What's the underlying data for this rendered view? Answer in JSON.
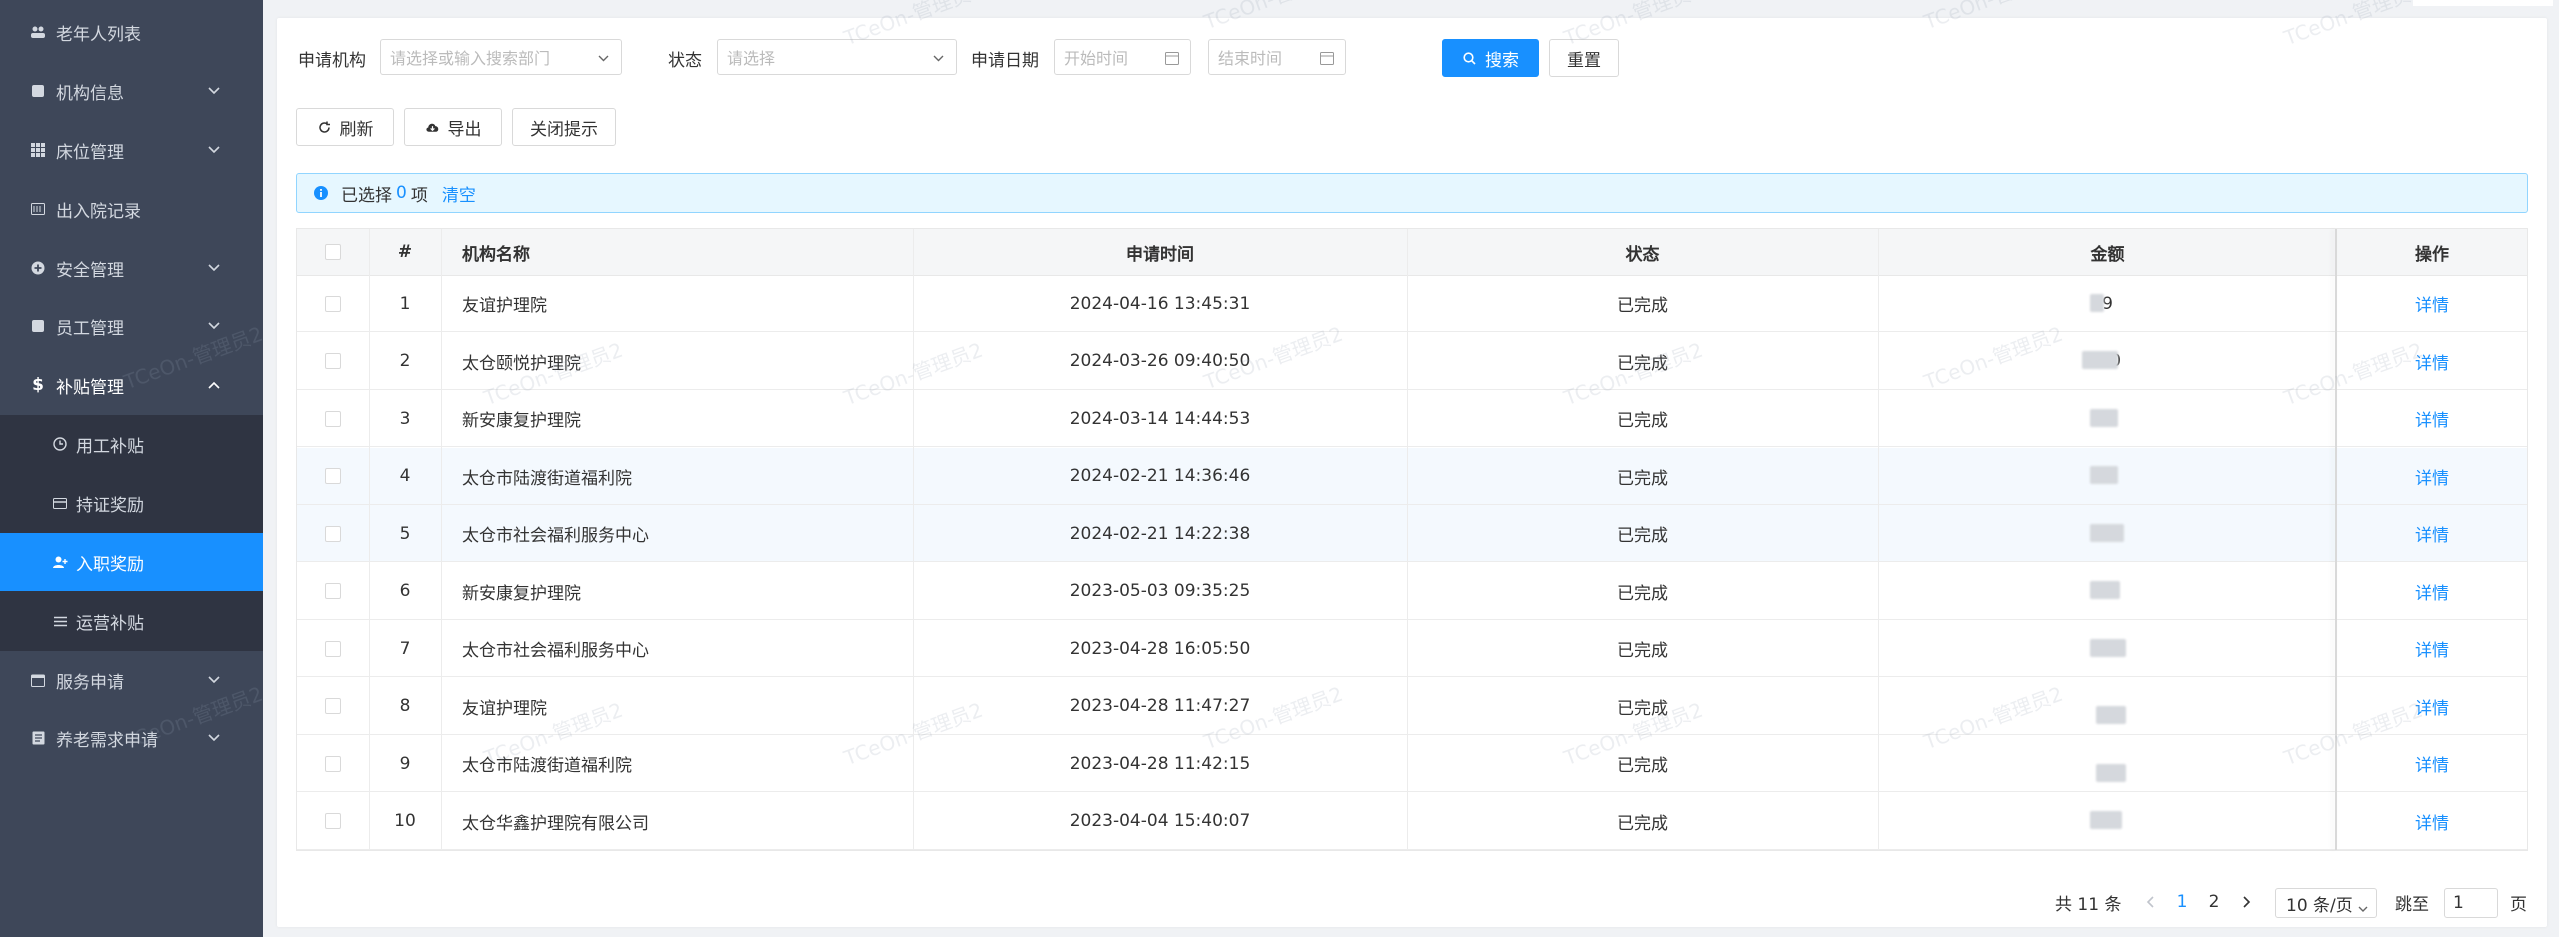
{
  "sidebar": {
    "items": [
      {
        "label": "老年人列表",
        "icon": "users-icon"
      },
      {
        "label": "机构信息",
        "icon": "building-icon"
      },
      {
        "label": "床位管理",
        "icon": "grid-icon"
      },
      {
        "label": "出入院记录",
        "icon": "record-icon"
      },
      {
        "label": "安全管理",
        "icon": "plus-circle-icon"
      },
      {
        "label": "员工管理",
        "icon": "staff-icon"
      },
      {
        "label": "补贴管理",
        "icon": "dollar-icon"
      },
      {
        "label": "用工补贴",
        "icon": "clock-icon"
      },
      {
        "label": "持证奖励",
        "icon": "card-icon"
      },
      {
        "label": "入职奖励",
        "icon": "user-add-icon"
      },
      {
        "label": "运营补贴",
        "icon": "list-icon"
      },
      {
        "label": "服务申请",
        "icon": "calendar-icon"
      },
      {
        "label": "养老需求申请",
        "icon": "form-icon"
      }
    ]
  },
  "filters": {
    "org_label": "申请机构",
    "org_placeholder": "请选择或输入搜索部门",
    "status_label": "状态",
    "status_placeholder": "请选择",
    "date_label": "申请日期",
    "start_placeholder": "开始时间",
    "end_placeholder": "结束时间",
    "search_label": "搜索",
    "reset_label": "重置"
  },
  "toolbar": {
    "refresh_label": "刷新",
    "export_label": "导出",
    "close_tip_label": "关闭提示"
  },
  "alert": {
    "prefix": "已选择",
    "count": "0",
    "suffix": "项",
    "clear_label": "清空"
  },
  "table": {
    "columns": [
      "#",
      "机构名称",
      "申请时间",
      "状态",
      "金额",
      "操作"
    ],
    "rows": [
      {
        "no": "1",
        "org": "友谊护理院",
        "time": "2024-04-16 13:45:31",
        "status": "已完成",
        "amount": "9",
        "action": "详情"
      },
      {
        "no": "2",
        "org": "太仓颐悦护理院",
        "time": "2024-03-26 09:40:50",
        "status": "已完成",
        "amount": "9 0",
        "action": "详情"
      },
      {
        "no": "3",
        "org": "新安康复护理院",
        "time": "2024-03-14 14:44:53",
        "status": "已完成",
        "amount": "0",
        "action": "详情"
      },
      {
        "no": "4",
        "org": "太仓市陆渡街道福利院",
        "time": "2024-02-21 14:36:46",
        "status": "已完成",
        "amount": "0",
        "action": "详情"
      },
      {
        "no": "5",
        "org": "太仓市社会福利服务中心",
        "time": "2024-02-21 14:22:38",
        "status": "已完成",
        "amount": "0",
        "action": "详情"
      },
      {
        "no": "6",
        "org": "新安康复护理院",
        "time": "2023-05-03 09:35:25",
        "status": "已完成",
        "amount": "0",
        "action": "详情"
      },
      {
        "no": "7",
        "org": "太仓市社会福利服务中心",
        "time": "2023-04-28 16:05:50",
        "status": "已完成",
        "amount": "0",
        "action": "详情"
      },
      {
        "no": "8",
        "org": "友谊护理院",
        "time": "2023-04-28 11:47:27",
        "status": "已完成",
        "amount": "",
        "action": "详情"
      },
      {
        "no": "9",
        "org": "太仓市陆渡街道福利院",
        "time": "2023-04-28 11:42:15",
        "status": "已完成",
        "amount": "",
        "action": "详情"
      },
      {
        "no": "10",
        "org": "太仓华鑫护理院有限公司",
        "time": "2023-04-04 15:40:07",
        "status": "已完成",
        "amount": "6",
        "action": "详情"
      }
    ]
  },
  "pagination": {
    "total": "共 11 条",
    "page1": "1",
    "page2": "2",
    "page_size": "10 条/页",
    "jump_label": "跳至",
    "jump_value": "1",
    "page_unit": "页"
  },
  "watermark": "TCeOn-管理员2",
  "colors": {
    "sidebar_bg": "#3e4759",
    "submenu_bg": "#2f3442",
    "accent": "#1890ff"
  }
}
